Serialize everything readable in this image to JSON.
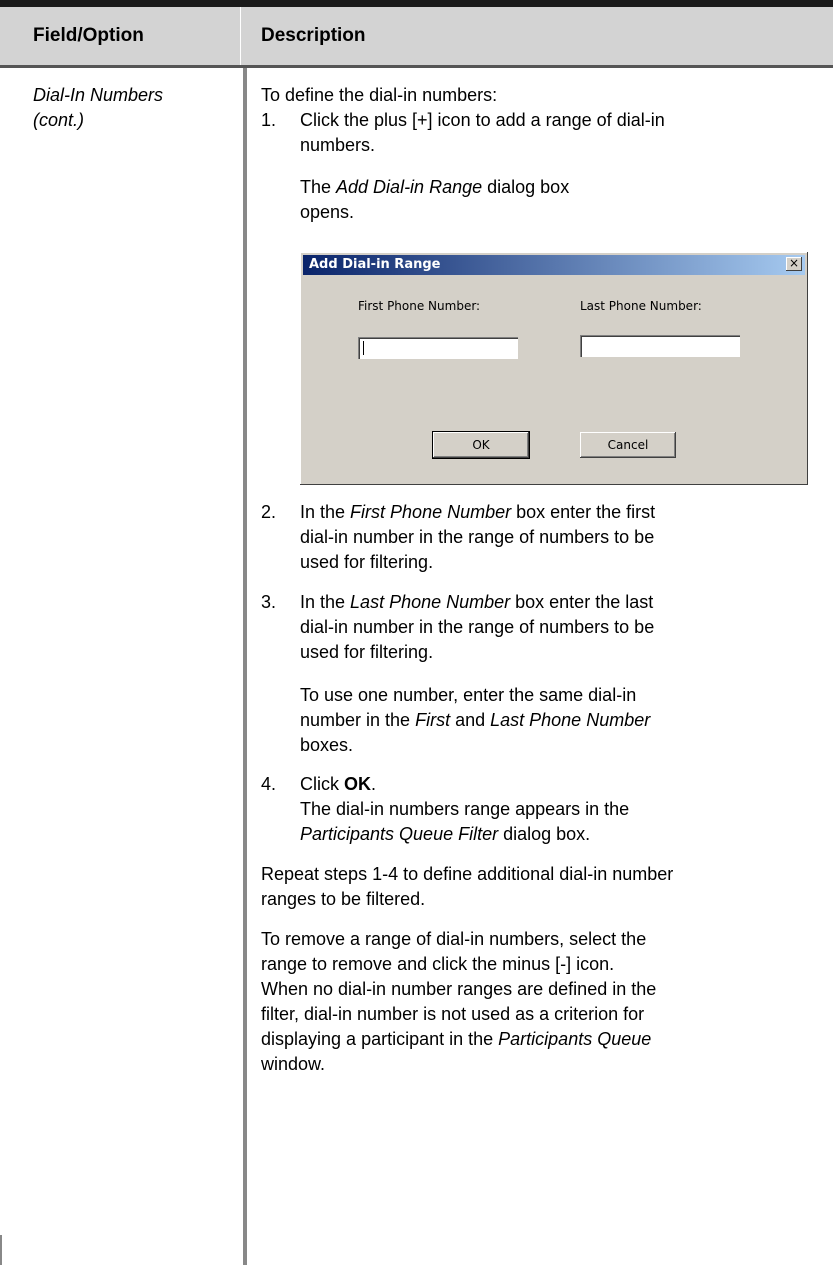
{
  "header": {
    "col1": "Field/Option",
    "col2": "Description"
  },
  "row": {
    "field_line1": "Dial-In Numbers",
    "field_line2": "(cont.)",
    "intro": "To define the dial-in numbers:",
    "step1": {
      "num": "1.",
      "line1": "Click the plus [+] icon to add a range of dial-in",
      "line2": "numbers.",
      "note_pre": "The ",
      "note_em": "Add Dial-in Range",
      "note_post": " dialog box",
      "note_line2": "opens."
    },
    "dialog": {
      "title": "Add Dial-in Range",
      "close": "×",
      "first_label": "First Phone Number:",
      "last_label": "Last Phone Number:",
      "ok": "OK",
      "cancel": "Cancel"
    },
    "step2": {
      "num": "2.",
      "l1_pre": "In the ",
      "l1_em": "First Phone Number",
      "l1_post": " box enter the first",
      "line2": "dial-in number in the range of numbers to be",
      "line3": "used for filtering."
    },
    "step3": {
      "num": "3.",
      "l1_pre": "In the ",
      "l1_em": "Last Phone Number",
      "l1_post": " box enter the last",
      "line2": "dial-in number in the range of numbers to be",
      "line3": "used for filtering.",
      "note_line1": "To use one number, enter the same dial-in",
      "n2_pre": "number in the ",
      "n2_em1": "First",
      "n2_mid": " and ",
      "n2_em2": "Last Phone Number",
      "note_line3": "boxes."
    },
    "step4": {
      "num": "4.",
      "l1_pre": "Click ",
      "l1_strong": "OK",
      "l1_post": ".",
      "line2": "The dial-in numbers range appears in the",
      "l3_em": "Participants Queue Filter",
      "l3_post": " dialog box."
    },
    "repeat_line1": "Repeat steps 1-4 to define additional dial-in number",
    "repeat_line2": "ranges to be filtered.",
    "remove_line1": "To remove a range of dial-in numbers, select the",
    "remove_line2": "range to remove and click the minus [-] icon.",
    "when_line1": "When no dial-in number ranges are defined in the",
    "when_line2": "filter, dial-in number is not used as a criterion for",
    "when_l3_pre": "displaying a participant in the ",
    "when_l3_em": "Participants Queue",
    "when_line4": "window."
  }
}
